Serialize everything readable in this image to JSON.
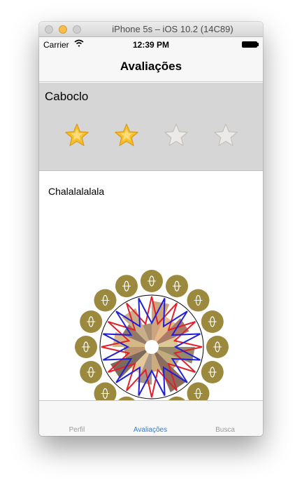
{
  "window": {
    "title": "iPhone 5s – iOS 10.2 (14C89)"
  },
  "status_bar": {
    "carrier": "Carrier",
    "time": "12:39 PM",
    "wifi_icon": "wifi-icon",
    "battery_icon": "battery-icon"
  },
  "nav": {
    "title": "Avaliações"
  },
  "rating": {
    "name": "Caboclo",
    "stars": [
      {
        "icon": "star-filled-icon",
        "filled": true
      },
      {
        "icon": "star-filled-icon",
        "filled": true
      },
      {
        "icon": "star-empty-icon",
        "filled": false
      },
      {
        "icon": "star-empty-icon",
        "filled": false
      }
    ],
    "value": 2,
    "max": 4
  },
  "comment": {
    "text": "Chalalalalala"
  },
  "artwork": {
    "icon": "emblem-icon"
  },
  "tabbar": {
    "items": [
      {
        "label": "Perfil",
        "selected": false
      },
      {
        "label": "Avaliações",
        "selected": true
      },
      {
        "label": "Busca",
        "selected": false
      }
    ],
    "selected_color": "#2a7ddc",
    "unselected_color": "#9b9b9b"
  },
  "colors": {
    "rating_background": "#d6d6d6",
    "star_fill": "#f7c02b",
    "medallion": "#9b8a3e",
    "zigzag_red": "#e2202a",
    "zigzag_blue": "#2020d8"
  }
}
